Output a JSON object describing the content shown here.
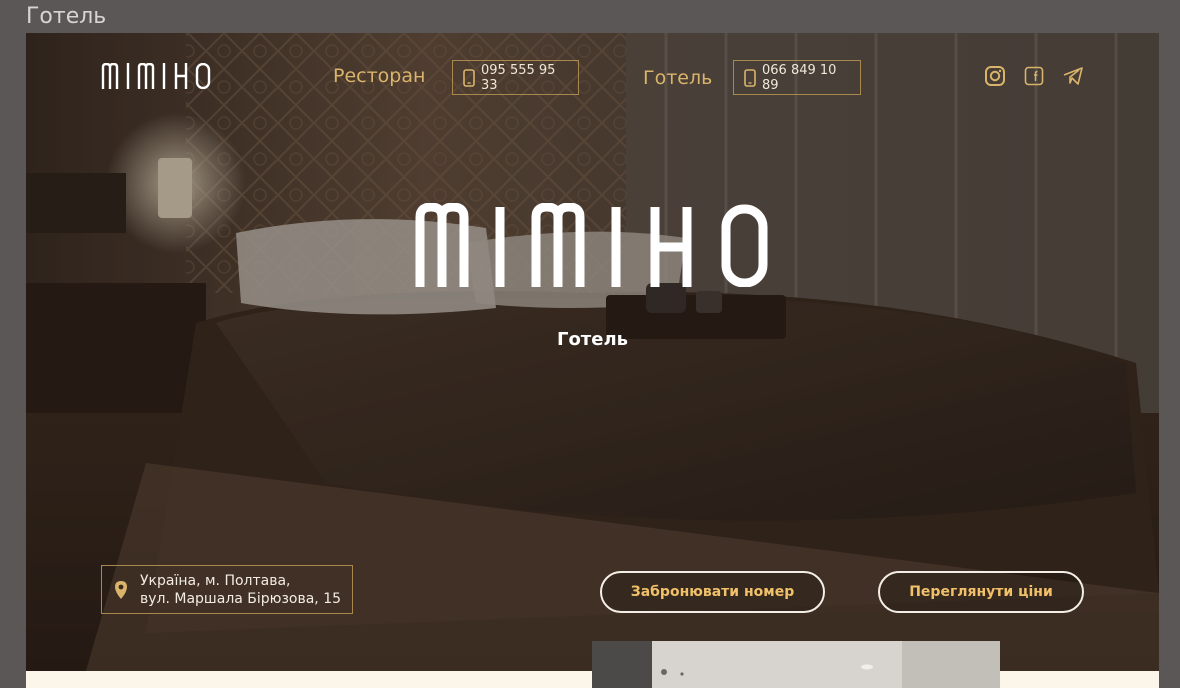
{
  "frame": {
    "title": "Готель"
  },
  "header": {
    "logo_alt": "MIMIHO",
    "nav": [
      {
        "label": "Ресторан",
        "phone": "095 555 95 33"
      },
      {
        "label": "Готель",
        "phone": "066 849 10 89"
      }
    ],
    "social": [
      "instagram-icon",
      "facebook-icon",
      "telegram-icon"
    ]
  },
  "hero": {
    "logo_text": "MIMIHO",
    "subtitle": "Готель",
    "address_line1": "Україна, м. Полтава,",
    "address_line2": "вул. Маршала Бірюзова, 15",
    "book_button": "Забронювати номер",
    "prices_button": "Переглянути ціни"
  },
  "colors": {
    "accent": "#d9b46a",
    "button_text": "#f1c16a",
    "border": "#a8884f",
    "cream": "#fbf6e9"
  }
}
